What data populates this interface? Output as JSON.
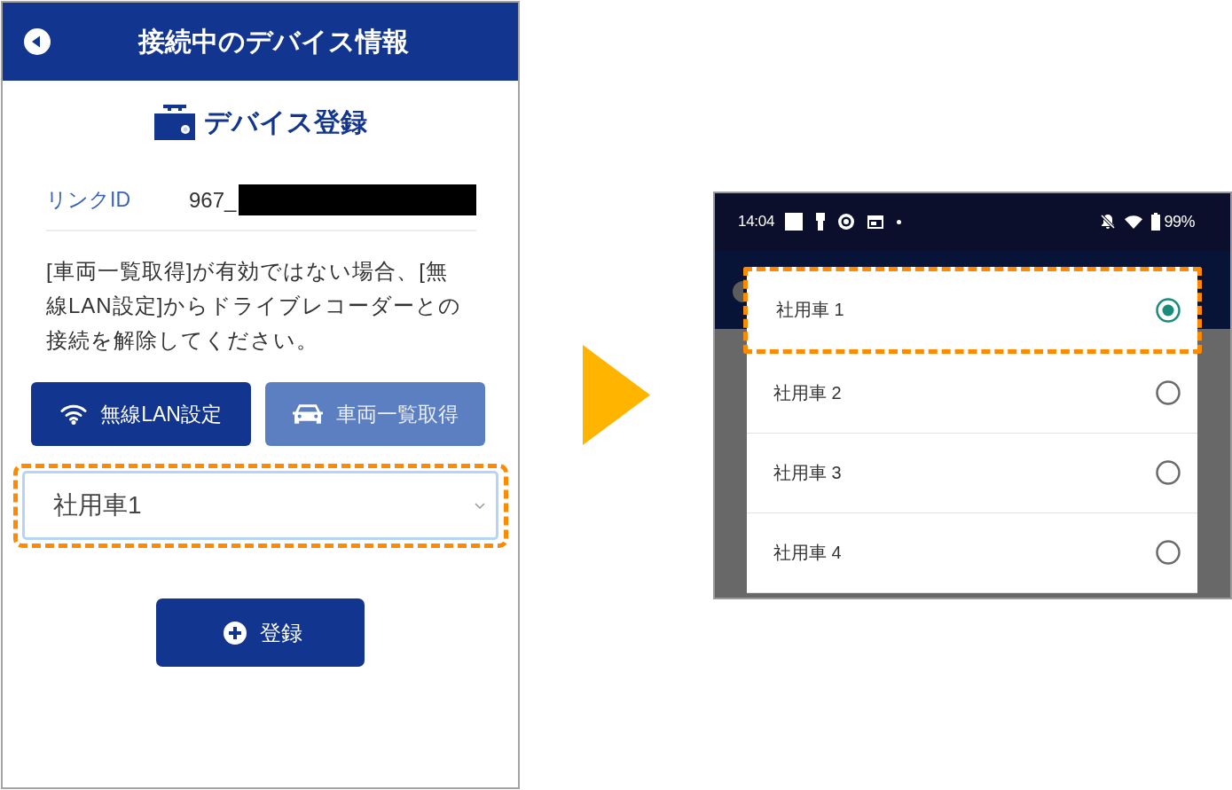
{
  "left_screen": {
    "header": {
      "title": "接続中のデバイス情報"
    },
    "section": {
      "title": "デバイス登録"
    },
    "link_id": {
      "label": "リンクID",
      "value": "967_",
      "redacted": true
    },
    "notice": "[車両一覧取得]が有効ではない場合、[無線LAN設定]からドライブレコーダーとの接続を解除してください。",
    "buttons": [
      {
        "kind": "wifi",
        "label": "無線LAN設定",
        "disabled": false
      },
      {
        "kind": "car",
        "label": "車両一覧取得",
        "disabled": true
      }
    ],
    "vehicle_select": {
      "value": "社用車1",
      "highlighted": true
    },
    "register_button": {
      "label": "登録"
    }
  },
  "right_screen": {
    "status_bar": {
      "time": "14:04",
      "battery": "99%"
    },
    "options": [
      {
        "label": "社用車 1",
        "selected": true,
        "highlighted": true
      },
      {
        "label": "社用車 2",
        "selected": false,
        "highlighted": false
      },
      {
        "label": "社用車 3",
        "selected": false,
        "highlighted": false
      },
      {
        "label": "社用車 4",
        "selected": false,
        "highlighted": false
      }
    ]
  }
}
